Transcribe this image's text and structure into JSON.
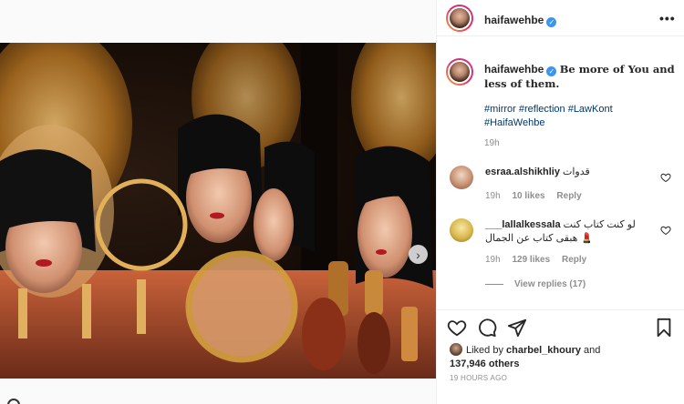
{
  "post": {
    "username": "haifawehbe",
    "verified_mark": "✓",
    "more_icon": "•••"
  },
  "caption": {
    "text": "Be more of You and less of them.",
    "hashtags": "#mirror #reflection #LawKont #HaifaWehbe",
    "time": "19h"
  },
  "comments": [
    {
      "username": "esraa.alshikhliy",
      "text": "قدوات",
      "time": "19h",
      "likes": "10 likes",
      "reply": "Reply"
    },
    {
      "username": "___lallalkessala",
      "text": "لو كنت كتاب كنت هبقى كتاب عن الجمال 💄",
      "time": "19h",
      "likes": "129 likes",
      "reply": "Reply"
    }
  ],
  "view_replies": "View replies (17)",
  "likes": {
    "prefix": "Liked by",
    "user": "charbel_khoury",
    "and": "and",
    "others": "137,946 others"
  },
  "time_ago": "19 HOURS AGO",
  "icons": {
    "heart": "heart-icon",
    "comment": "comment-icon",
    "share": "paper-plane-icon",
    "save": "bookmark-icon",
    "next": "chevron-right-icon"
  },
  "next_arrow": "›"
}
